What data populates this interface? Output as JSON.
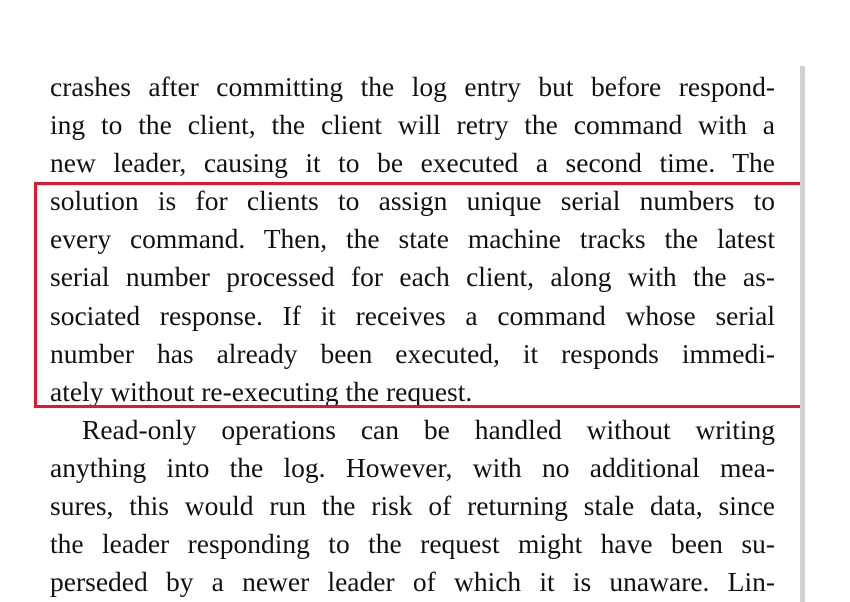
{
  "paragraph1": {
    "lines": [
      "crashes after committing the log entry but before respond-",
      "ing to the client, the client will retry the command with a",
      "new leader, causing it to be executed a second time. The",
      "solution is for clients to assign unique serial numbers to",
      "every command. Then, the state machine tracks the latest",
      "serial number processed for each client, along with the as-",
      "sociated response. If it receives a command whose serial",
      "number has already been executed, it responds immedi-",
      "ately without re-executing the request."
    ]
  },
  "paragraph2": {
    "lines": [
      "Read-only operations can be handled without writing",
      "anything into the log. However, with no additional mea-",
      "sures, this would run the risk of returning stale data, since",
      "the leader responding to the request might have been su-",
      "perseded by a newer leader of which it is unaware. Lin-"
    ]
  },
  "highlight": {
    "color": "#e3182d"
  }
}
